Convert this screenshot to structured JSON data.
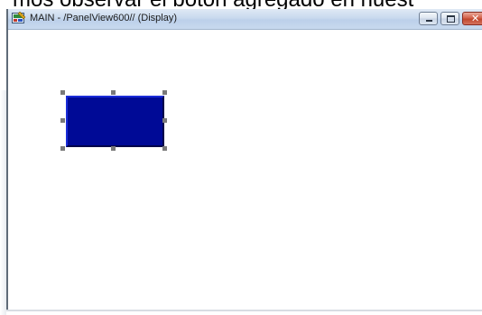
{
  "caption": {
    "text": "mos observar el botón agregado en nuest"
  },
  "window": {
    "title": "MAIN - /PanelView600// (Display)",
    "icon": "display-app-icon",
    "controls": {
      "minimize": "minimize-icon",
      "maximize": "maximize-icon",
      "close": "close-icon"
    }
  },
  "canvas": {
    "background": "#ffffff",
    "objects": [
      {
        "type": "button",
        "color": "#000a96",
        "selected": true
      }
    ]
  },
  "colors": {
    "titlebar": "#c9daee",
    "button_fill": "#000a96",
    "selection_handle": "#7a7a7a",
    "close_button": "#c0452c"
  }
}
